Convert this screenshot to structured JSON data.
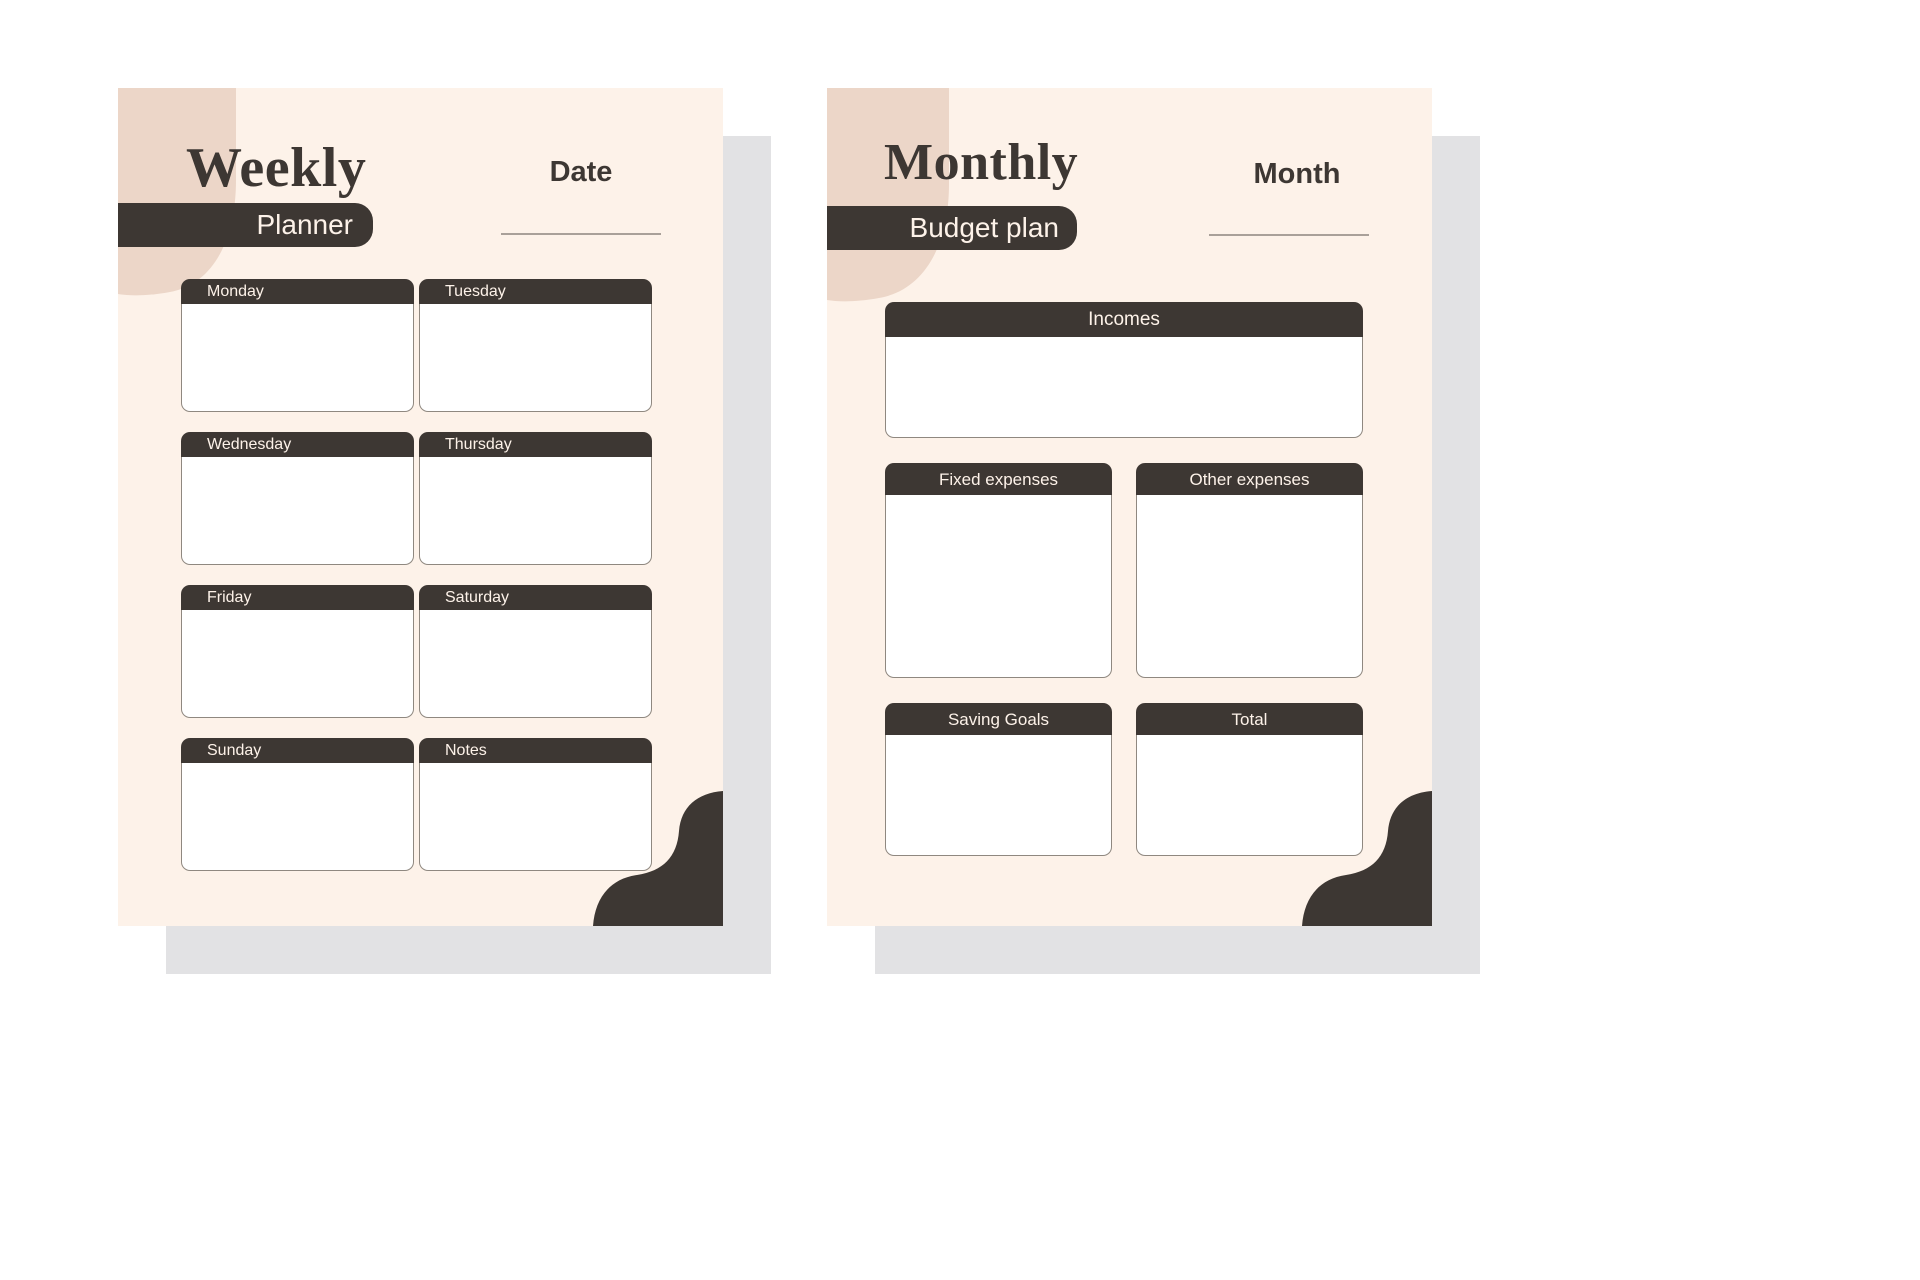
{
  "theme": {
    "page_bg": "#ffffff",
    "card_bg": "#fdf2e9",
    "card_shadow": "#e2e2e4",
    "dark": "#3d3733",
    "pink_blob": "#ecd6c8",
    "rule": "#a9a099",
    "field_bg": "#ffffff",
    "field_border": "#8f8880"
  },
  "weekly": {
    "title": "Weekly",
    "subtitle": "Planner",
    "meta_label": "Date",
    "boxes": [
      {
        "label": "Monday"
      },
      {
        "label": "Tuesday"
      },
      {
        "label": "Wednesday"
      },
      {
        "label": "Thursday"
      },
      {
        "label": "Friday"
      },
      {
        "label": "Saturday"
      },
      {
        "label": "Sunday"
      },
      {
        "label": "Notes"
      }
    ]
  },
  "monthly": {
    "title": "Monthly",
    "subtitle": "Budget plan",
    "meta_label": "Month",
    "incomes": {
      "label": "Incomes"
    },
    "expenses": [
      {
        "label": "Fixed expenses"
      },
      {
        "label": "Other expenses"
      }
    ],
    "totals": [
      {
        "label": "Saving Goals"
      },
      {
        "label": "Total"
      }
    ]
  }
}
